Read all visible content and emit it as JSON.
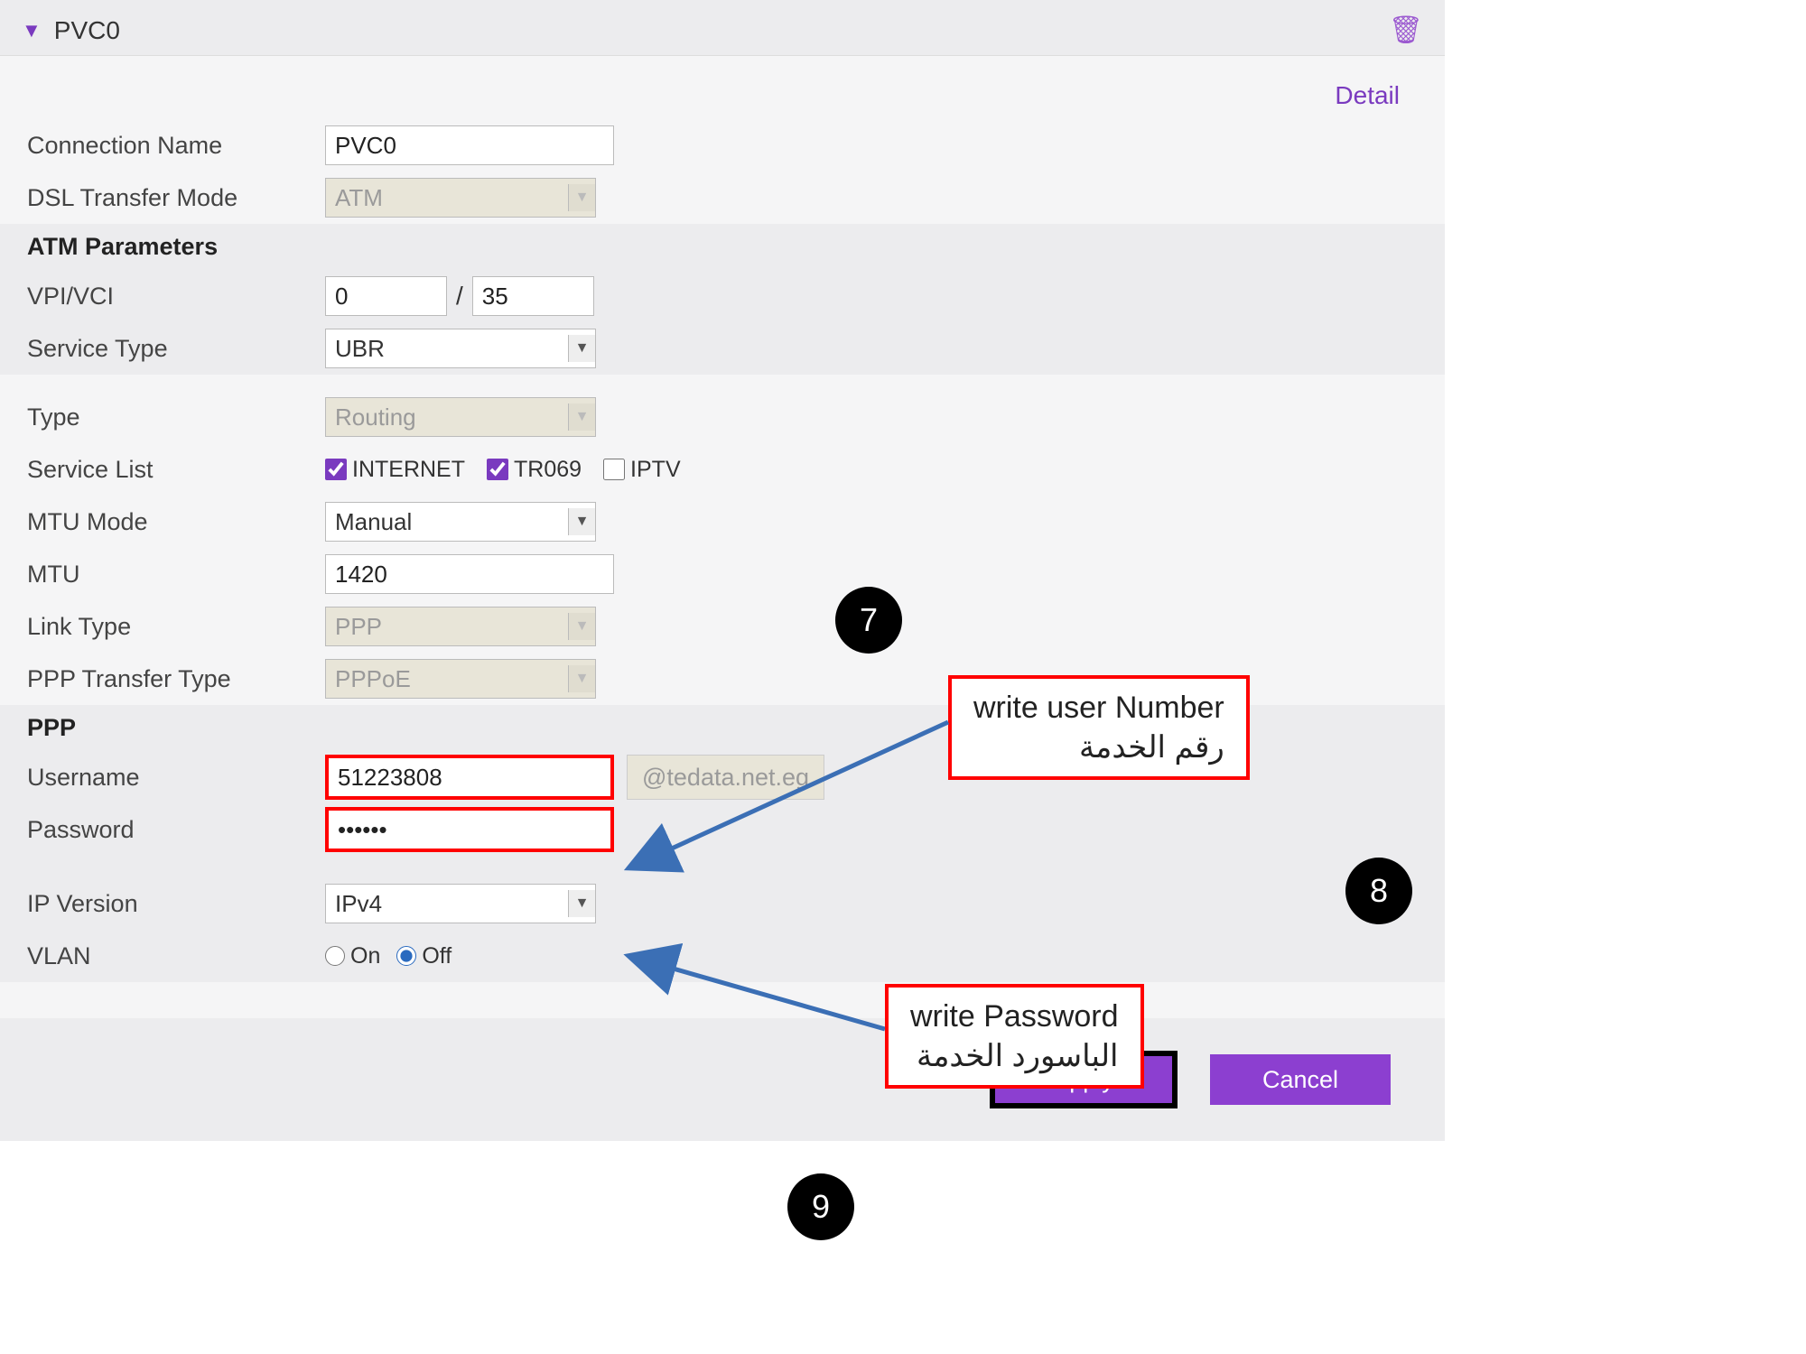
{
  "header": {
    "title": "PVC0",
    "detail_label": "Detail"
  },
  "labels": {
    "connection_name": "Connection Name",
    "dsl_transfer_mode": "DSL Transfer Mode",
    "atm_parameters": "ATM Parameters",
    "vpi_vci": "VPI/VCI",
    "service_type": "Service Type",
    "type": "Type",
    "service_list": "Service List",
    "mtu_mode": "MTU Mode",
    "mtu": "MTU",
    "link_type": "Link Type",
    "ppp_transfer_type": "PPP Transfer Type",
    "ppp": "PPP",
    "username": "Username",
    "password": "Password",
    "ip_version": "IP Version",
    "vlan": "VLAN"
  },
  "values": {
    "connection_name": "PVC0",
    "dsl_transfer_mode": "ATM",
    "vpi": "0",
    "vci": "35",
    "service_type": "UBR",
    "type": "Routing",
    "mtu_mode": "Manual",
    "mtu": "1420",
    "link_type": "PPP",
    "ppp_transfer_type": "PPPoE",
    "username": "51223808",
    "username_suffix": "@tedata.net.eg",
    "password": "••••••",
    "ip_version": "IPv4",
    "vlan": "Off"
  },
  "service_list": {
    "internet": "INTERNET",
    "tr069": "TR069",
    "iptv": "IPTV"
  },
  "vlan_options": {
    "on": "On",
    "off": "Off"
  },
  "buttons": {
    "apply": "Apply",
    "cancel": "Cancel"
  },
  "annotations": {
    "callout7_en": "write user Number",
    "callout7_ar": "رقم الخدمة",
    "callout8_en": "write Password",
    "callout8_ar": "الباسورد الخدمة",
    "badge7": "7",
    "badge8": "8",
    "badge9": "9"
  }
}
